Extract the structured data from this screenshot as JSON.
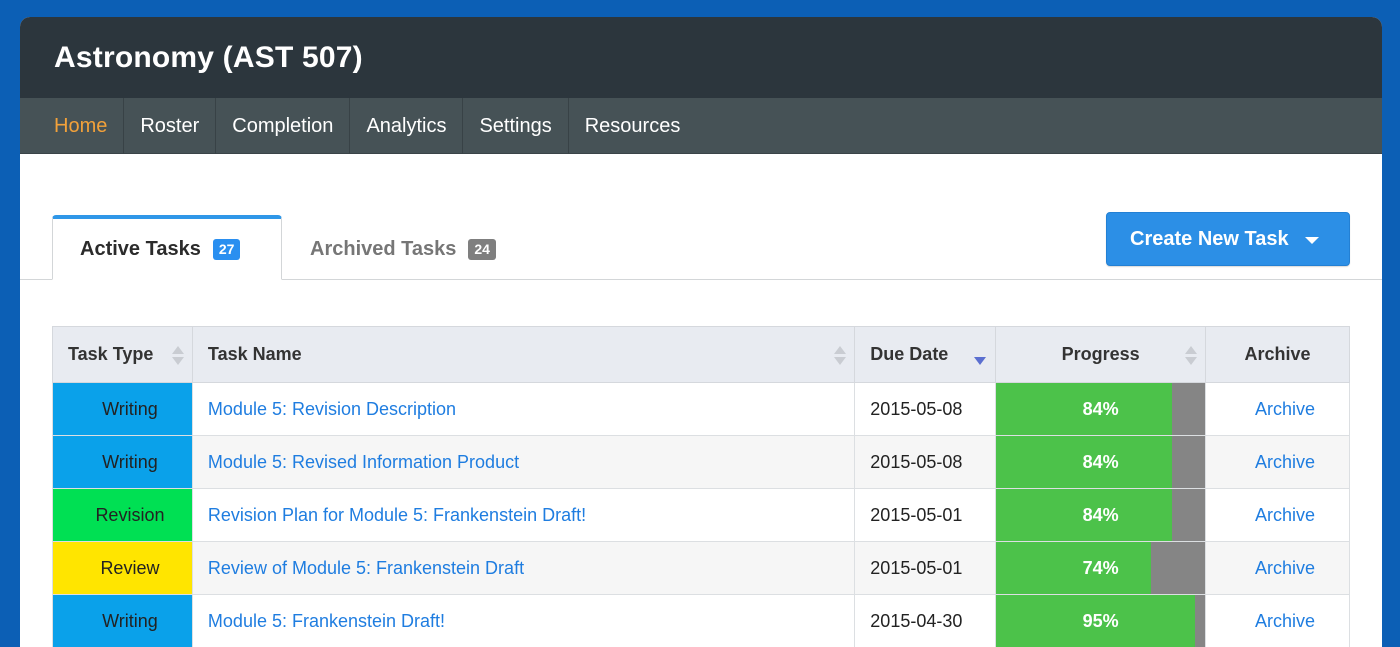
{
  "app": {
    "title": "Astronomy (AST 507)"
  },
  "nav": {
    "items": [
      {
        "label": "Home",
        "active": true
      },
      {
        "label": "Roster"
      },
      {
        "label": "Completion"
      },
      {
        "label": "Analytics"
      },
      {
        "label": "Settings"
      },
      {
        "label": "Resources"
      }
    ]
  },
  "tabs": [
    {
      "label": "Active Tasks",
      "count": "27",
      "active": true
    },
    {
      "label": "Archived Tasks",
      "count": "24"
    }
  ],
  "toolbar": {
    "create_label": "Create New Task"
  },
  "table": {
    "headers": [
      "Task Type",
      "Task Name",
      "Due Date",
      "Progress",
      "Archive"
    ],
    "rows": [
      {
        "type": "Writing",
        "type_color": "#0aa1ea",
        "name": "Module 5: Revision Description",
        "due": "2015-05-08",
        "progress": 84,
        "progress_label": "84%",
        "archive": "Archive"
      },
      {
        "type": "Writing",
        "type_color": "#0aa1ea",
        "name": "Module 5: Revised Information Product",
        "due": "2015-05-08",
        "progress": 84,
        "progress_label": "84%",
        "archive": "Archive"
      },
      {
        "type": "Revision",
        "type_color": "#00e053",
        "name": "Revision Plan for Module 5: Frankenstein Draft!",
        "due": "2015-05-01",
        "progress": 84,
        "progress_label": "84%",
        "archive": "Archive"
      },
      {
        "type": "Review",
        "type_color": "#ffe500",
        "name": "Review of Module 5: Frankenstein Draft",
        "due": "2015-05-01",
        "progress": 74,
        "progress_label": "74%",
        "archive": "Archive"
      },
      {
        "type": "Writing",
        "type_color": "#0aa1ea",
        "name": "Module 5: Frankenstein Draft!",
        "due": "2015-04-30",
        "progress": 95,
        "progress_label": "95%",
        "archive": "Archive"
      }
    ]
  },
  "colors": {
    "accent": "#2c8fe6",
    "nav_active": "#f2a13a",
    "progress_fill": "#4cc24a",
    "progress_track": "#858585"
  }
}
